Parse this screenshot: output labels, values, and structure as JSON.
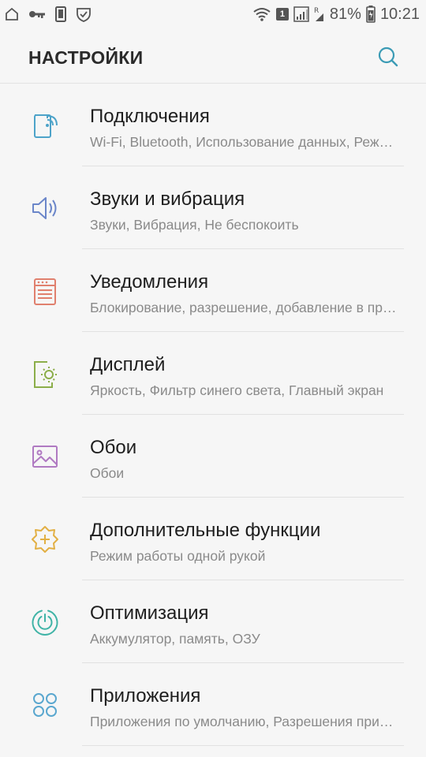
{
  "status_bar": {
    "battery": "81%",
    "time": "10:21",
    "sim_slot": "1",
    "left_icons": [
      "home-outline-icon",
      "key-icon",
      "phone-block-icon",
      "shield-check-icon"
    ],
    "right_icons": [
      "wifi-icon",
      "sim-signal-icon",
      "cell-signal-icon",
      "battery-icon"
    ]
  },
  "header": {
    "title": "НАСТРОЙКИ",
    "search_icon": "search-icon",
    "accent_color": "#3b9bb5"
  },
  "items": [
    {
      "title": "Подключения",
      "subtitle": "Wi-Fi, Bluetooth, Использование данных, Режим полета",
      "icon": "connections-icon",
      "color": "#4da3c9"
    },
    {
      "title": "Звуки и вибрация",
      "subtitle": "Звуки, Вибрация, Не беспокоить",
      "icon": "speaker-icon",
      "color": "#6b86c9"
    },
    {
      "title": "Уведомления",
      "subtitle": "Блокирование, разрешение, добавление в приоритет",
      "icon": "notifications-icon",
      "color": "#e0806e"
    },
    {
      "title": "Дисплей",
      "subtitle": "Яркость, Фильтр синего света, Главный экран",
      "icon": "display-icon",
      "color": "#8cae4a"
    },
    {
      "title": "Обои",
      "subtitle": "Обои",
      "icon": "wallpaper-icon",
      "color": "#b07ac2"
    },
    {
      "title": "Дополнительные функции",
      "subtitle": "Режим работы одной рукой",
      "icon": "advanced-features-icon",
      "color": "#e2b044"
    },
    {
      "title": "Оптимизация",
      "subtitle": "Аккумулятор, память, ОЗУ",
      "icon": "optimization-icon",
      "color": "#3fb3a6"
    },
    {
      "title": "Приложения",
      "subtitle": "Приложения по умолчанию, Разрешения приложений",
      "icon": "apps-icon",
      "color": "#5aa7cf"
    }
  ]
}
